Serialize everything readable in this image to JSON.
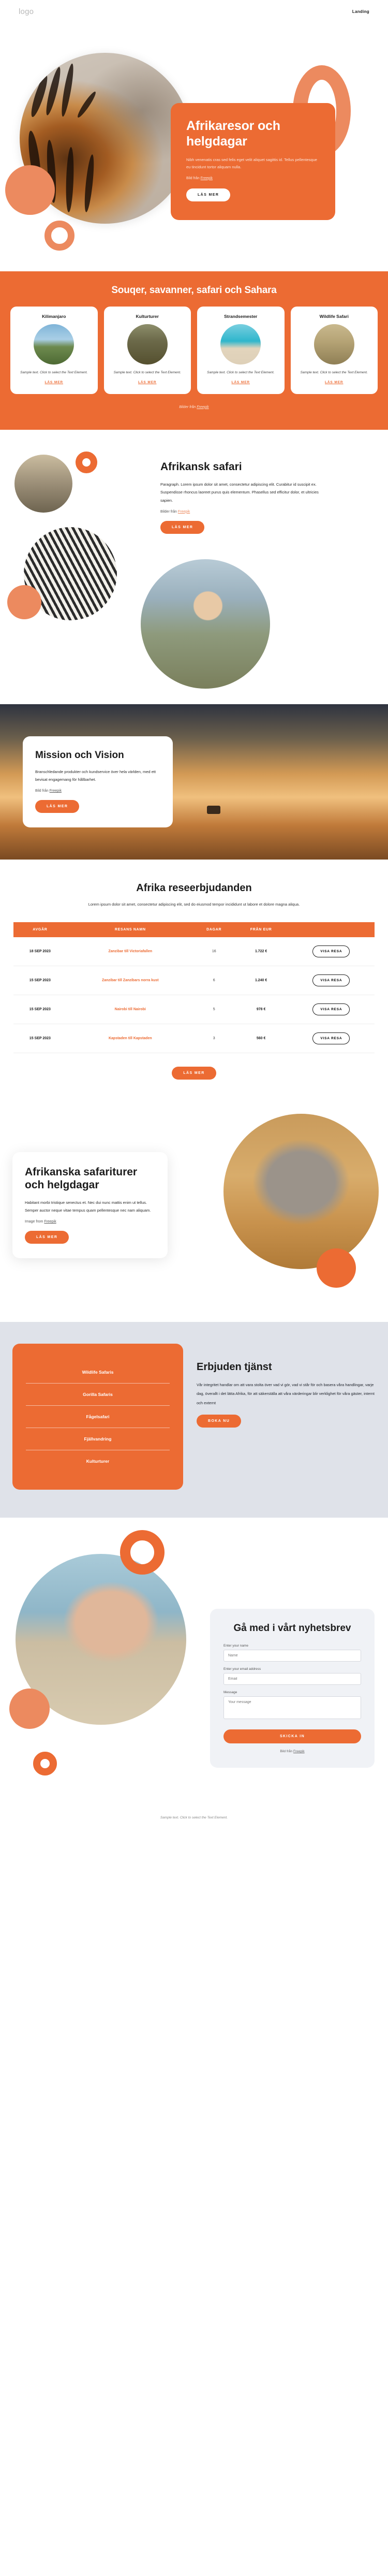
{
  "header": {
    "logo": "logo",
    "nav_link": "Landing"
  },
  "hero": {
    "title": "Afrikaresor och helgdagar",
    "lede": "Nibh venenatis cras sed felis eget velit aliquet sagittis id. Tellus pellentesque eu tincidunt tortor aliquam nulla.",
    "credit_prefix": "Bild från ",
    "credit_link": "Freepik",
    "button": "LÄS MER"
  },
  "band": {
    "title": "Souqer, savanner, safari och Sahara",
    "credit_prefix": "Bilder från ",
    "credit_link": "Freepik",
    "cards": [
      {
        "title": "Kilimanjaro",
        "text": "Sample text. Click to select the Text Element.",
        "link": "LÄS MER",
        "img": "kilimanjaro-photo"
      },
      {
        "title": "Kulturturer",
        "text": "Sample text. Click to select the Text Element.",
        "link": "LÄS MER",
        "img": "culture-photo"
      },
      {
        "title": "Strandsemester",
        "text": "Sample text. Click to select the Text Element.",
        "link": "LÄS MER",
        "img": "beach-photo"
      },
      {
        "title": "Wildlife Safari",
        "text": "Sample text. Click to select the Text Element.",
        "link": "LÄS MER",
        "img": "cheetah-photo"
      }
    ]
  },
  "safari": {
    "title": "Afrikansk safari",
    "body": "Paragraph. Lorem ipsum dolor sit amet, consectetur adipiscing elit. Curabitur id suscipit ex. Suspendisse rhoncus laoreet purus quis elementum. Phasellus sed efficitur dolor, et ultricies sapien.",
    "credit_prefix": "Bilder från ",
    "credit_link": "Freepik",
    "button": "LÄS MER"
  },
  "mission": {
    "title": "Mission och Vision",
    "body": "Branschledande produkter och kundservice över hela världen, med ett bevisat engagemang för hållbarhet.",
    "credit_prefix": "Bild från ",
    "credit_link": "Freepik",
    "button": "LÄS MER"
  },
  "offers": {
    "title": "Afrika reseerbjudanden",
    "subtitle": "Lorem ipsum dolor sit amet, consectetur adipiscing elit, sed do eiusmod tempor incididunt ut labore et dolore magna aliqua.",
    "columns": [
      "AVGÅR",
      "RESANS NAMN",
      "DAGAR",
      "FRÅN EUR",
      ""
    ],
    "rows": [
      {
        "departure": "18 SEP 2023",
        "name": "Zanzibar till Victoriafallen",
        "days": "16",
        "price": "1.722 €",
        "action": "VISA RESA"
      },
      {
        "departure": "15 SEP 2023",
        "name": "Zanzibar till Zanzibars norra kust",
        "days": "6",
        "price": "1.240 €",
        "action": "VISA RESA"
      },
      {
        "departure": "15 SEP 2023",
        "name": "Nairobi till Nairobi",
        "days": "5",
        "price": "978 €",
        "action": "VISA RESA"
      },
      {
        "departure": "15 SEP 2023",
        "name": "Kapstaden till Kapstaden",
        "days": "3",
        "price": "560 €",
        "action": "VISA RESA"
      }
    ],
    "button": "LÄS MER"
  },
  "tours": {
    "title": "Afrikanska safariturer och helgdagar",
    "body": "Habitant morbi tristique senectus et. Nec dui nunc mattis enim ut tellus. Semper auctor neque vitae tempus quam pellentesque nec nam aliquam.",
    "credit_prefix": "Image from ",
    "credit_link": "Freepik",
    "button": "LÄS MER"
  },
  "services": {
    "items": [
      "Wildlife Safaris",
      "Gorilla Safaris",
      "Fågelsafari",
      "Fjällvandring",
      "Kulturturer"
    ],
    "title": "Erbjuden tjänst",
    "body": "Vår integritet handlar om att vara stolta över vad vi gör, vad vi står för och basera våra handlingar, varje dag, överallt i det lätta Afrika, för att säkerställa att våra värderingar blir verklighet för våra gäster, internt och externt",
    "button": "BOKA NU"
  },
  "newsletter": {
    "title": "Gå med i vårt nyhetsbrev",
    "fields": [
      {
        "label": "Enter your name",
        "placeholder": "Name"
      },
      {
        "label": "Enter your email address",
        "placeholder": "Email"
      },
      {
        "label": "Message",
        "placeholder": "Your message"
      }
    ],
    "submit": "SKICKA IN",
    "credit_prefix": "Bild från ",
    "credit_link": "Freepik"
  },
  "footer": {
    "text": "Sample text. Click to select the Text Element."
  },
  "colors": {
    "accent": "#ec6b33",
    "accent_light": "#ec8a5f",
    "services_bg": "#dfe2e9"
  }
}
